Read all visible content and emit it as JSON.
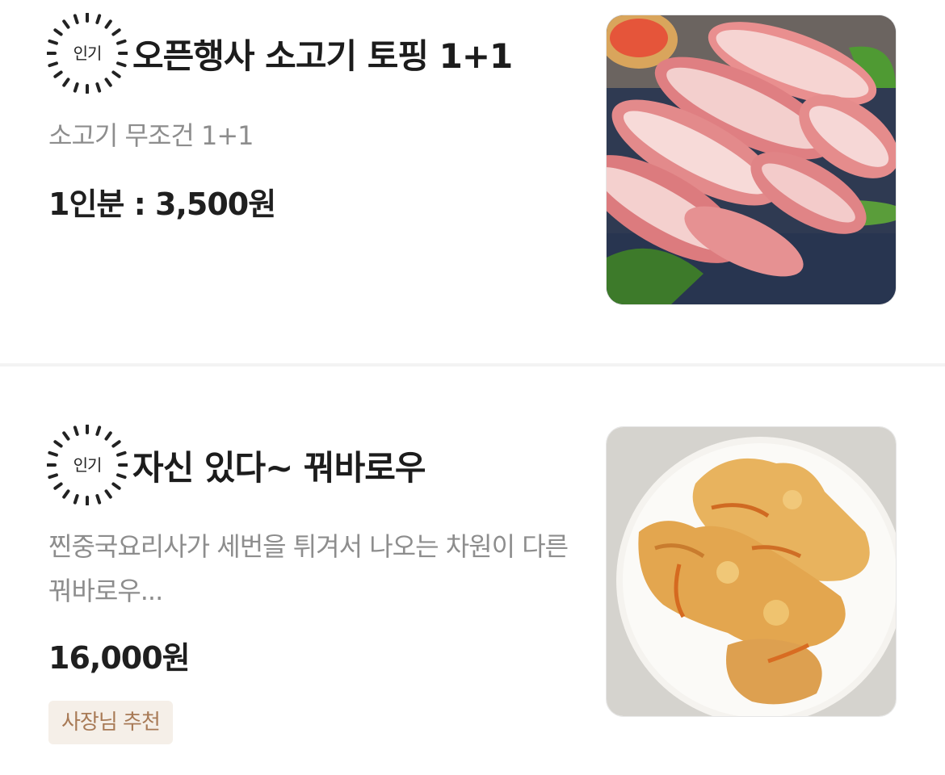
{
  "items": [
    {
      "badge": "인기",
      "name": "오픈행사 소고기 토핑 1+1",
      "description": "소고기 무조건 1+1",
      "price": "1인분 : 3,500원",
      "image": "beef-slices-image"
    },
    {
      "badge": "인기",
      "name": "자신 있다~ 꿔바로우",
      "description": "찐중국요리사가 세번을 튀겨서 나오는 차원이 다른 꿔바로우...",
      "price": "16,000원",
      "tag": "사장님 추천",
      "image": "fried-pork-image"
    }
  ],
  "colors": {
    "divider": "#f3f3f3",
    "description": "#8d8d8d",
    "tag_background": "#f5efe8",
    "tag_text": "#a87a56"
  }
}
